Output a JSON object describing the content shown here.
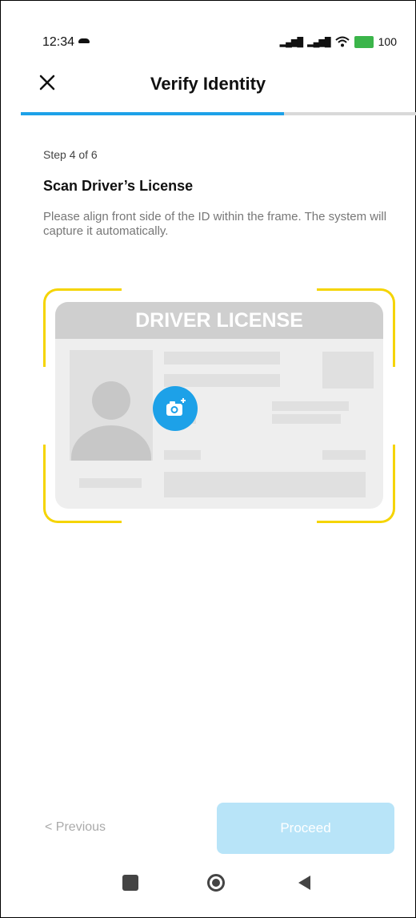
{
  "status_bar": {
    "time": "12:34",
    "battery": "100",
    "icons": [
      "cloud-icon",
      "signal-icon",
      "signal-icon",
      "wifi-icon",
      "battery-charging-icon"
    ]
  },
  "header": {
    "title": "Verify Identity",
    "close_icon": "close-icon"
  },
  "progress": {
    "current": 4,
    "total": 6,
    "color": "#1da1e8"
  },
  "content": {
    "step_label": "Step 4 of 6",
    "heading": "Scan Driver’s License",
    "description": "Please align front side of the ID within the frame. The system will capture it automatically."
  },
  "card": {
    "header_text": "DRIVER LICENSE",
    "camera_icon": "camera-add-icon",
    "frame_color": "#f5d400"
  },
  "footer": {
    "previous_label": "Previous",
    "proceed_label": "Proceed",
    "accent": "#b8e4f8"
  },
  "nav_bar": {
    "icons": [
      "recents-icon",
      "home-icon",
      "back-icon"
    ]
  }
}
